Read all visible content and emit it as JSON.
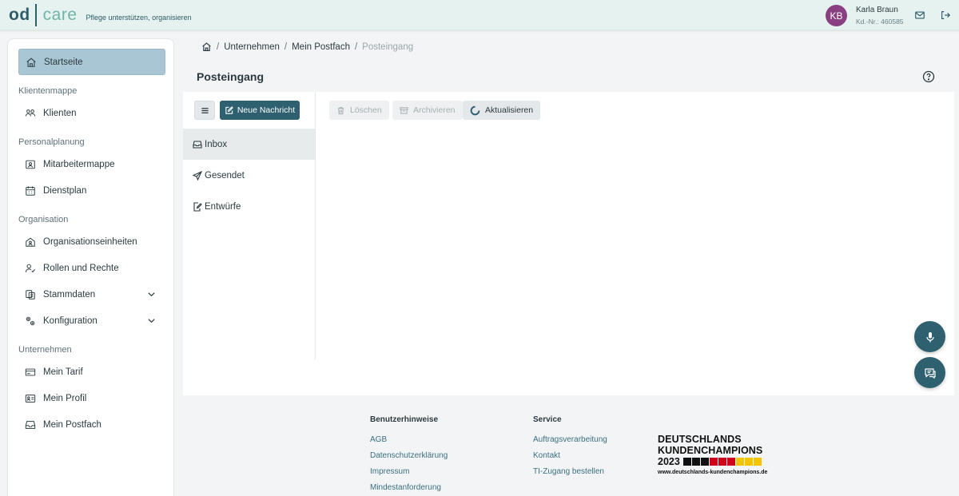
{
  "header": {
    "logo_left": "od",
    "logo_right": "care",
    "tagline": "Pflege unterstützen, organisieren",
    "avatar_initials": "KB",
    "user_name": "Karla Braun",
    "customer_number": "Kd.-Nr.: 460585",
    "icons": [
      "mail-icon",
      "logout-icon"
    ],
    "avatar_color": "#8a3f82"
  },
  "sidebar": {
    "home": "Startseite",
    "sections": [
      {
        "title": "Klientenmappe",
        "items": [
          {
            "label": "Klienten",
            "icon": "users-icon"
          }
        ]
      },
      {
        "title": "Personalplanung",
        "items": [
          {
            "label": "Mitarbeitermappe",
            "icon": "id-badge-icon"
          },
          {
            "label": "Dienstplan",
            "icon": "calendar-icon"
          }
        ]
      },
      {
        "title": "Organisation",
        "items": [
          {
            "label": "Organisationseinheiten",
            "icon": "building-icon"
          },
          {
            "label": "Rollen und Rechte",
            "icon": "user-check-icon"
          },
          {
            "label": "Stammdaten",
            "icon": "database-icon"
          },
          {
            "label": "Konfiguration",
            "icon": "settings-icon"
          }
        ]
      },
      {
        "title": "Unternehmen",
        "items": [
          {
            "label": "Mein Tarif",
            "icon": "credit-card-icon"
          },
          {
            "label": "Mein Profil",
            "icon": "profile-card-icon"
          },
          {
            "label": "Mein Postfach",
            "icon": "inbox-icon"
          }
        ]
      }
    ]
  },
  "breadcrumb": [
    "Unternehmen",
    "Mein Postfach",
    "Posteingang"
  ],
  "page_title": "Posteingang",
  "mailbox": {
    "new_message": "Neue Nachricht",
    "folders": [
      "Inbox",
      "Gesendet",
      "Entwürfe"
    ],
    "toolbar": {
      "delete": "Löschen",
      "archive": "Archivieren",
      "refresh": "Aktualisieren"
    }
  },
  "footer": {
    "col1_title": "Benutzerhinweise",
    "col1_links": [
      "AGB",
      "Datenschutzerklärung",
      "Impressum",
      "Mindestanforderung"
    ],
    "col2_title": "Service",
    "col2_links": [
      "Auftragsverarbeitung",
      "Kontakt",
      "TI-Zugang bestellen"
    ],
    "badge": {
      "line1": "DEUTSCHLANDS",
      "line2": "KUNDENCHAMPIONS",
      "year": "2023",
      "url": "www.deutschlands-kundenchampions.de"
    }
  },
  "colors": {
    "accent": "#2e6070",
    "header_bg": "#e6f2ef",
    "active_nav": "#a9c6d5"
  }
}
